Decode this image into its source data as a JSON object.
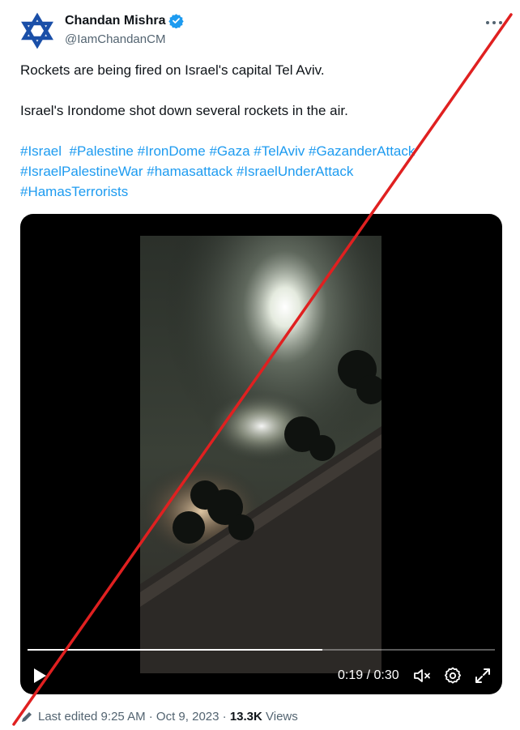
{
  "author": {
    "name": "Chandan Mishra",
    "handle": "@IamChandanCM",
    "avatar_icon": "star-of-david-icon",
    "verified_color": "#1d9bf0"
  },
  "tweet": {
    "line1": "Rockets are being fired on Israel's capital Tel Aviv.",
    "line2": "Israel's Irondome shot down several rockets in the air.",
    "hashtags": [
      "#Israel",
      "#Palestine",
      "#IronDome",
      "#Gaza",
      "#TelAviv",
      "#GazanderAttack",
      "#IsraelPalestineWar",
      "#hamasattack",
      "#IsraelUnderAttack",
      "#HamasTerrorists"
    ]
  },
  "video": {
    "time": "0:19 / 0:30",
    "progress": 0.63
  },
  "meta": {
    "edited": "Last edited 9:25 AM · Oct 9, 2023 · ",
    "views_count": "13.3K",
    "views_label": " Views"
  },
  "colors": {
    "link": "#1d9bf0",
    "secondary_text": "#536471",
    "strike_line": "#e02020"
  }
}
